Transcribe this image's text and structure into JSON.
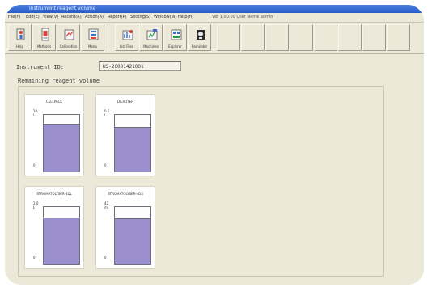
{
  "window": {
    "title": "Instrument reagent volume"
  },
  "menu": {
    "items": [
      "File(F)",
      "Edit(E)",
      "View(V)",
      "Record(R)",
      "Action(A)",
      "Report(P)",
      "Setting(S)",
      "Window(W)",
      "Help(H)"
    ],
    "info": "Ver 1.00.00 User Name admin"
  },
  "toolbar": {
    "buttons": [
      {
        "label": "Help",
        "icon": "help-icon"
      },
      {
        "label": "Methods",
        "icon": "methods-icon"
      },
      {
        "label": "Calibration",
        "icon": "calibration-icon"
      },
      {
        "label": "Menu",
        "icon": "menu-icon"
      },
      {
        "label": "List Files",
        "icon": "list-files-icon"
      },
      {
        "label": "Machines",
        "icon": "machines-icon"
      },
      {
        "label": "Explorer",
        "icon": "explorer-icon"
      },
      {
        "label": "Reminder",
        "icon": "reminder-icon"
      }
    ]
  },
  "instrument": {
    "label": "Instrument ID:",
    "value": "HS-20001421001"
  },
  "reagents": {
    "group_label": "Remaining reagent volume",
    "cards": [
      {
        "name": "CELLPACK",
        "max": "20 L",
        "min": "0",
        "level": 0.85
      },
      {
        "name": "DILRUTER",
        "max": "0.5 L",
        "min": "0",
        "level": 0.78
      },
      {
        "name": "STROMATOLYSER-4DL",
        "max": "2.0 L",
        "min": "0",
        "level": 0.82
      },
      {
        "name": "STROMATOLYSER-4DS",
        "max": "42 ml",
        "min": "0",
        "level": 0.8
      }
    ]
  },
  "colors": {
    "fill": "#9b8fce",
    "titlebar": "#2a5cc8"
  }
}
